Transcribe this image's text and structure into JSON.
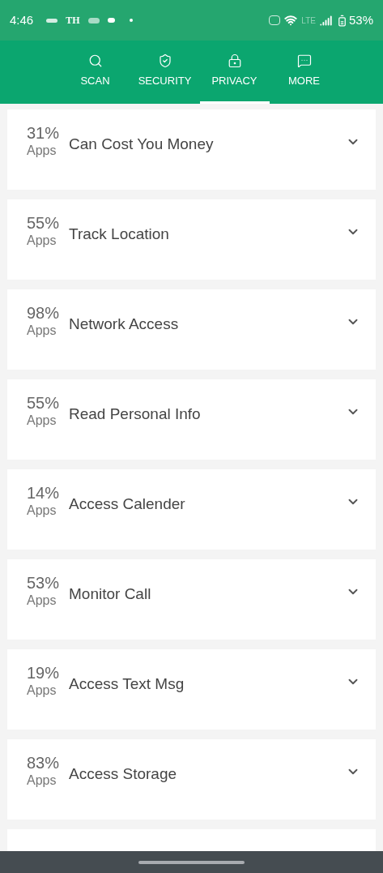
{
  "status_bar": {
    "time": "4:46",
    "notification_text": "TH",
    "network_label": "LTE",
    "battery": "53%"
  },
  "tabs": [
    {
      "label": "SCAN",
      "kind": "scan",
      "selected": false
    },
    {
      "label": "SECURITY",
      "kind": "security",
      "selected": false
    },
    {
      "label": "PRIVACY",
      "kind": "privacy",
      "selected": true
    },
    {
      "label": "MORE",
      "kind": "more",
      "selected": false
    }
  ],
  "permissions": [
    {
      "percent": "31%",
      "unit": "Apps",
      "title": "Can Cost You Money",
      "expanded": false
    },
    {
      "percent": "55%",
      "unit": "Apps",
      "title": "Track Location",
      "expanded": false
    },
    {
      "percent": "98%",
      "unit": "Apps",
      "title": "Network Access",
      "expanded": false
    },
    {
      "percent": "55%",
      "unit": "Apps",
      "title": "Read Personal Info",
      "expanded": false
    },
    {
      "percent": "14%",
      "unit": "Apps",
      "title": "Access Calender",
      "expanded": false
    },
    {
      "percent": "53%",
      "unit": "Apps",
      "title": "Monitor Call",
      "expanded": false
    },
    {
      "percent": "19%",
      "unit": "Apps",
      "title": "Access Text Msg",
      "expanded": false
    },
    {
      "percent": "83%",
      "unit": "Apps",
      "title": "Access Storage",
      "expanded": false
    }
  ]
}
